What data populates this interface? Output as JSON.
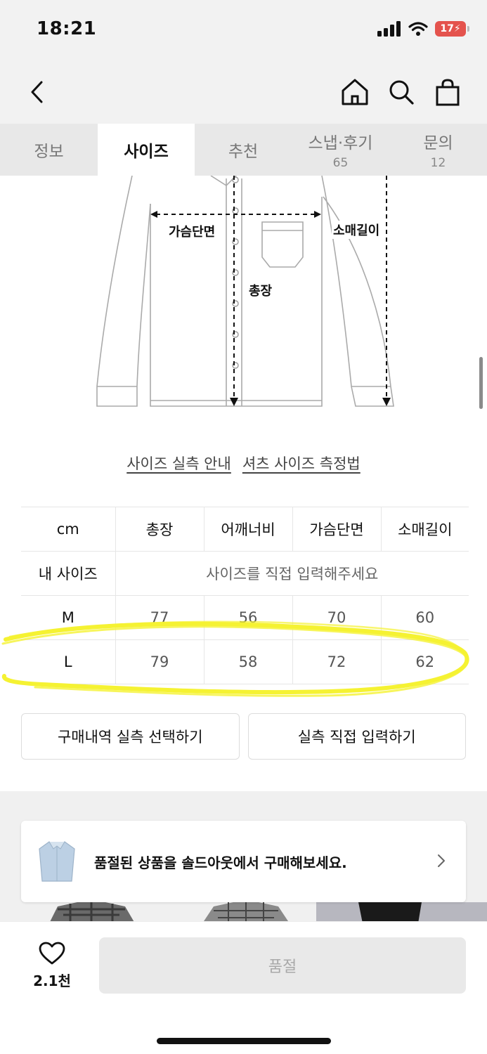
{
  "status_bar": {
    "time": "18:21",
    "battery": "17"
  },
  "nav": {
    "back_icon": "chevron-left-icon",
    "home_icon": "home-icon",
    "search_icon": "search-icon",
    "bag_icon": "shopping-bag-icon"
  },
  "tabs": [
    {
      "label": "정보",
      "count": ""
    },
    {
      "label": "사이즈",
      "count": ""
    },
    {
      "label": "추천",
      "count": ""
    },
    {
      "label": "스냅·후기",
      "count": "65"
    },
    {
      "label": "문의",
      "count": "12"
    }
  ],
  "diagram": {
    "chest": "가슴단면",
    "sleeve": "소매길이",
    "length": "총장"
  },
  "links": {
    "guide": "사이즈 실측 안내",
    "measure": "셔츠 사이즈 측정법"
  },
  "table": {
    "headers": [
      "cm",
      "총장",
      "어깨너비",
      "가슴단면",
      "소매길이"
    ],
    "my_size_label": "내 사이즈",
    "my_size_placeholder": "사이즈를 직접 입력해주세요",
    "rows": [
      {
        "size": "M",
        "values": [
          "77",
          "56",
          "70",
          "60"
        ]
      },
      {
        "size": "L",
        "values": [
          "79",
          "58",
          "72",
          "62"
        ]
      }
    ]
  },
  "buttons": {
    "purchase_history": "구매내역 실측 선택하기",
    "direct_input": "실측 직접 입력하기"
  },
  "soldout_banner": {
    "text": "품절된 상품을 솔드아웃에서 구매해보세요."
  },
  "bottom": {
    "like_count": "2.1천",
    "cta": "품절"
  },
  "colors": {
    "highlight": "#f5f232",
    "tab_bg": "#e8e8e8",
    "header_bg": "#f2f2f2"
  }
}
